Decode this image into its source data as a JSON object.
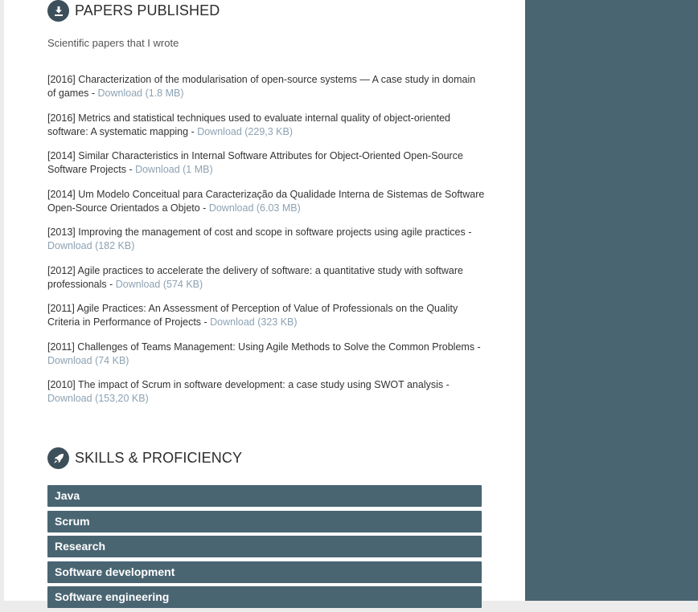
{
  "papers_section": {
    "title": "PAPERS PUBLISHED",
    "icon": "download-icon",
    "intro": "Scientific papers that I wrote",
    "items": [
      {
        "citation": "[2016] Characterization of the modularisation of open-source systems — A case study in domain of games",
        "sep": " - ",
        "download": "Download (1.8 MB)"
      },
      {
        "citation": "[2016] Metrics and statistical techniques used to evaluate internal quality of object-oriented software: A systematic mapping",
        "sep": " - ",
        "download": "Download (229,3 KB)"
      },
      {
        "citation": "[2014] Similar Characteristics in Internal Software Attributes for Object-Oriented Open-Source Software Projects",
        "sep": " - ",
        "download": "Download (1 MB)"
      },
      {
        "citation": "[2014] Um Modelo Conceitual para Caracterização da Qualidade Interna de Sistemas de Software Open-Source Orientados a Objeto",
        "sep": " - ",
        "download": "Download (6.03 MB)"
      },
      {
        "citation": "[2013] Improving the management of cost and scope in software projects using agile practices",
        "sep": " - ",
        "download": "Download (182 KB)"
      },
      {
        "citation": "[2012] Agile practices to accelerate the delivery of software: a quantitative study with software professionals",
        "sep": " - ",
        "download": "Download (574 KB)"
      },
      {
        "citation": "[2011] Agile Practices: An Assessment of Perception of Value of Professionals on the Quality Criteria in Performance of Projects",
        "sep": " - ",
        "download": "Download (323 KB)"
      },
      {
        "citation": "[2011] Challenges of Teams Management: Using Agile Methods to Solve the Common Problems",
        "sep": " - ",
        "download": "Download (74 KB)"
      },
      {
        "citation": "[2010] The impact of Scrum in software development: a case study using SWOT analysis",
        "sep": " - ",
        "download": "Download (153,20 KB)"
      }
    ]
  },
  "skills_section": {
    "title": "SKILLS & PROFICIENCY",
    "icon": "rocket-icon",
    "items": [
      "Java",
      "Scrum",
      "Research",
      "Software development",
      "Software engineering"
    ]
  },
  "colors": {
    "sidebar": "#4a6572",
    "skill_bar": "#4a6572",
    "link": "#8da2b3",
    "icon_circle": "#3d4f5a"
  }
}
